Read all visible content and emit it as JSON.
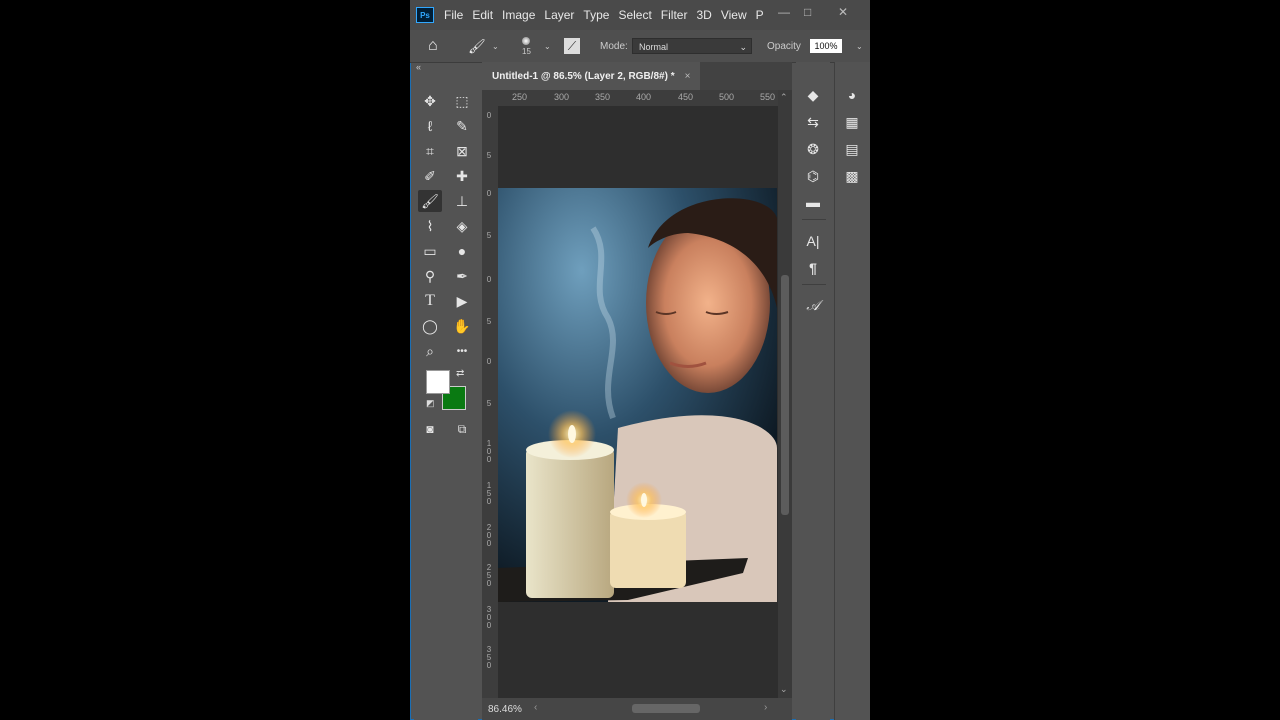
{
  "app": {
    "logo": "Ps"
  },
  "menu": [
    "File",
    "Edit",
    "Image",
    "Layer",
    "Type",
    "Select",
    "Filter",
    "3D",
    "View",
    "P"
  ],
  "window_controls": {
    "minimize": "—",
    "restore": "□",
    "close": "✕"
  },
  "options": {
    "brush_size": "15",
    "mode_label": "Mode:",
    "mode_value": "Normal",
    "opacity_label": "Opacity",
    "opacity_value": "100%"
  },
  "document": {
    "tab_title": "Untitled-1 @ 86.5% (Layer 2, RGB/8#) *",
    "close_glyph": "×",
    "zoom": "86.46%"
  },
  "ruler": {
    "horizontal": [
      "250",
      "300",
      "350",
      "400",
      "450",
      "500",
      "550"
    ],
    "vertical": [
      "0",
      "5",
      "0",
      "5",
      "0",
      "5",
      "0",
      "5",
      "1\n0\n0",
      "1\n5\n0",
      "2\n0\n0",
      "2\n5\n0",
      "3\n0\n0",
      "3\n5\n0",
      "4\n0\n0",
      "4\n5\n0",
      "5\n0\n0",
      "5\n5\n0"
    ]
  },
  "tools": [
    {
      "name": "move-tool",
      "icon": "✥"
    },
    {
      "name": "marquee-tool",
      "icon": "⬚"
    },
    {
      "name": "lasso-tool",
      "icon": "ℓ"
    },
    {
      "name": "quick-select-tool",
      "icon": "✎"
    },
    {
      "name": "crop-tool",
      "icon": "⌗"
    },
    {
      "name": "frame-tool",
      "icon": "⊠"
    },
    {
      "name": "eyedropper-tool",
      "icon": "✐"
    },
    {
      "name": "healing-tool",
      "icon": "✚"
    },
    {
      "name": "brush-tool",
      "icon": "🖌"
    },
    {
      "name": "stamp-tool",
      "icon": "⊥"
    },
    {
      "name": "history-brush-tool",
      "icon": "⌇"
    },
    {
      "name": "eraser-tool",
      "icon": "◈"
    },
    {
      "name": "gradient-tool",
      "icon": "▭"
    },
    {
      "name": "blur-tool",
      "icon": "●"
    },
    {
      "name": "dodge-tool",
      "icon": "⚲"
    },
    {
      "name": "pen-tool",
      "icon": "✒"
    },
    {
      "name": "type-tool",
      "icon": "T"
    },
    {
      "name": "path-select-tool",
      "icon": "▶"
    },
    {
      "name": "ellipse-tool",
      "icon": "◯"
    },
    {
      "name": "hand-tool",
      "icon": "✋"
    },
    {
      "name": "zoom-tool",
      "icon": "⌕"
    },
    {
      "name": "more-tools",
      "icon": "•••"
    }
  ],
  "colors": {
    "foreground": "#ffffff",
    "background": "#0a7a12",
    "accent": "#31a8ff"
  },
  "right_panel_a": [
    {
      "name": "layers-icon",
      "icon": "◆"
    },
    {
      "name": "history-icon",
      "icon": "⇆"
    },
    {
      "name": "channels-icon",
      "icon": "❂"
    },
    {
      "name": "paths-icon",
      "icon": "⌬"
    },
    {
      "name": "comments-icon",
      "icon": "▬"
    },
    {
      "name": "character-icon",
      "icon": "A|"
    },
    {
      "name": "paragraph-icon",
      "icon": "¶"
    },
    {
      "name": "glyphs-icon",
      "icon": "𝒜"
    }
  ],
  "right_panel_b": [
    {
      "name": "color-icon",
      "icon": "◕"
    },
    {
      "name": "swatches-icon",
      "icon": "▦"
    },
    {
      "name": "gradients-icon",
      "icon": "▤"
    },
    {
      "name": "patterns-icon",
      "icon": "▩"
    }
  ]
}
